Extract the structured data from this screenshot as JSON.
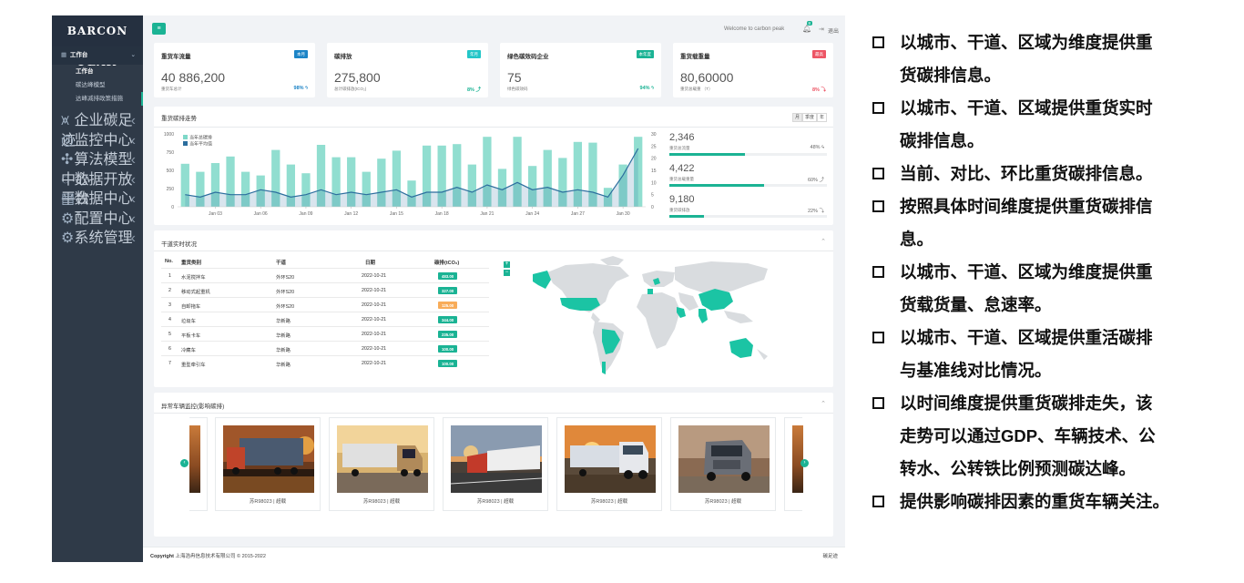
{
  "sidebar": {
    "logo": "BARCON PEAK",
    "workbench": {
      "label": "工作台",
      "subs": [
        "工作台",
        "碳达峰模型",
        "达峰减排政策措施"
      ]
    },
    "items": [
      {
        "label": "企业碳足迹",
        "icon": "graph-icon"
      },
      {
        "label": "监控中心",
        "icon": "eye-icon"
      },
      {
        "label": "算法模型中心",
        "icon": "puzzle-icon"
      },
      {
        "label": "数据开放平台",
        "icon": "circle-icon"
      },
      {
        "label": "数据中心",
        "icon": "database-icon"
      },
      {
        "label": "配置中心",
        "icon": "settings-icon"
      },
      {
        "label": "系统管理",
        "icon": "gears-icon"
      }
    ]
  },
  "topbar": {
    "menu_icon": "≡",
    "welcome": "Welcome to carbon peak",
    "bell_count": "8",
    "logout": "退出"
  },
  "stats": [
    {
      "title": "重货车流量",
      "tag": "本月",
      "tag_color": "#1c84c6",
      "value": "40 886,200",
      "sub": "重货车总计",
      "pct": "98%",
      "pct_color": "#1c84c6"
    },
    {
      "title": "碳排放",
      "tag": "年月",
      "tag_color": "#23c6c8",
      "value": "275,800",
      "sub": "总计碳排放(tCO₂)",
      "pct": "8%",
      "pct_color": "#1ab394"
    },
    {
      "title": "绿色碳效码企业",
      "tag": "本年度",
      "tag_color": "#1ab394",
      "value": "75",
      "sub": "绿色碳效码",
      "pct": "94%",
      "pct_color": "#1ab394"
    },
    {
      "title": "重货载重量",
      "tag": "最高",
      "tag_color": "#ed5565",
      "value": "80,60000",
      "sub": "重货总载重 （T）",
      "pct": "8%",
      "pct_color": "#ed5565"
    }
  ],
  "trend": {
    "title": "重货碳排走势",
    "tabs": [
      "月",
      "季度",
      "年"
    ],
    "kpis": [
      {
        "value": "2,346",
        "label": "重货总流量",
        "pct": "48%",
        "progress": 0.48
      },
      {
        "value": "4,422",
        "label": "重货总载重量",
        "pct": "60%",
        "progress": 0.6
      },
      {
        "value": "9,180",
        "label": "重货碳排放",
        "pct": "22%",
        "progress": 0.22
      }
    ]
  },
  "chart_data": {
    "type": "bar",
    "x": [
      "Jan 01",
      "Jan 02",
      "Jan 03",
      "Jan 04",
      "Jan 05",
      "Jan 06",
      "Jan 07",
      "Jan 08",
      "Jan 09",
      "Jan 10",
      "Jan 11",
      "Jan 12",
      "Jan 13",
      "Jan 14",
      "Jan 15",
      "Jan 16",
      "Jan 17",
      "Jan 18",
      "Jan 19",
      "Jan 20",
      "Jan 21",
      "Jan 22",
      "Jan 23",
      "Jan 24",
      "Jan 25",
      "Jan 26",
      "Jan 27",
      "Jan 28",
      "Jan 29",
      "Jan 30",
      "Jan 31"
    ],
    "xticks": [
      "Jan 03",
      "Jan 06",
      "Jan 09",
      "Jan 12",
      "Jan 15",
      "Jan 18",
      "Jan 21",
      "Jan 24",
      "Jan 27",
      "Jan 30"
    ],
    "series": [
      {
        "name": "当年总碳排",
        "type": "bar",
        "axis": "left",
        "color": "#7ed8c8",
        "values": [
          590,
          480,
          600,
          690,
          480,
          430,
          780,
          580,
          460,
          850,
          680,
          680,
          480,
          660,
          770,
          360,
          840,
          840,
          860,
          580,
          960,
          520,
          960,
          560,
          780,
          670,
          890,
          880,
          260,
          580,
          960
        ]
      },
      {
        "name": "当年平均值",
        "type": "line",
        "axis": "right",
        "color": "#2c6e9e",
        "values": [
          5,
          4,
          6,
          5,
          5,
          7,
          6,
          4,
          5,
          7,
          5,
          6,
          5,
          6,
          7,
          4,
          6,
          6,
          8,
          6,
          9,
          7,
          10,
          7,
          8,
          6,
          7,
          6,
          4,
          13,
          24
        ]
      }
    ],
    "ylim_left": [
      0,
      1000
    ],
    "yticks_left": [
      0,
      250,
      500,
      750,
      1000
    ],
    "ylim_right": [
      0,
      30
    ],
    "yticks_right": [
      0,
      5,
      10,
      15,
      20,
      25,
      30
    ],
    "legend": "top-left",
    "grid": false
  },
  "routes": {
    "title": "干道实时状况",
    "headers": [
      "No.",
      "重货类别",
      "干道",
      "日期",
      "碳排(tCO₂)"
    ],
    "rows": [
      {
        "no": "1",
        "type": "水泥搅拌车",
        "road": "外环S20",
        "date": "2022-10-21",
        "value": "483.00",
        "color": "#1ab394"
      },
      {
        "no": "2",
        "type": "移动式起重机",
        "road": "外环S20",
        "date": "2022-10-21",
        "value": "327.00",
        "color": "#1ab394"
      },
      {
        "no": "3",
        "type": "自卸拖车",
        "road": "外环S20",
        "date": "2022-10-21",
        "value": "125.00",
        "color": "#f8ac59"
      },
      {
        "no": "4",
        "type": "垃圾车",
        "road": "华新路",
        "date": "2022-10-21",
        "value": "344.00",
        "color": "#1ab394"
      },
      {
        "no": "5",
        "type": "平板卡车",
        "road": "华新路",
        "date": "2022-10-21",
        "value": "235.00",
        "color": "#1ab394"
      },
      {
        "no": "6",
        "type": "冷藏车",
        "road": "华新路",
        "date": "2022-10-21",
        "value": "100.00",
        "color": "#1ab394"
      },
      {
        "no": "7",
        "type": "重型牵引车",
        "road": "华新路",
        "date": "2022-10-21",
        "value": "100.00",
        "color": "#1ab394"
      }
    ],
    "zoom_in": "+",
    "zoom_out": "−"
  },
  "vehicles": {
    "title": "异常车辆监控(影响碳排)",
    "items": [
      {
        "caption": "苏R98023 | 超载"
      },
      {
        "caption": "苏R98023 | 超载"
      },
      {
        "caption": "苏R98023 | 超载"
      },
      {
        "caption": "苏R98023 | 超载"
      },
      {
        "caption": "苏R98023 | 超载"
      }
    ],
    "prev": "‹",
    "next": "›"
  },
  "footer": {
    "copyright_bold": "Copyright",
    "copyright": " 上海浩冉信息技术有限公司 © 2015-2022",
    "right": "碳足迹"
  },
  "notes": [
    "以城市、干道、区域为维度提供重货碳排信息。",
    "以城市、干道、区域提供重货实时碳排信息。",
    "当前、对比、环比重货碳排信息。",
    "按照具体时间维度提供重货碳排信息。",
    "以城市、干道、区域为维度提供重货载货量、怠速率。",
    "以城市、干道、区域提供重活碳排与基准线对比情况。",
    "以时间维度提供重货碳排走失，该走势可以通过GDP、车辆技术、公转水、公转铁比例预测碳达峰。",
    "提供影响碳排因素的重货车辆关注。"
  ],
  "note_lines": [
    [
      "以城市、干道、区域为维度提供重",
      "货碳排信息。"
    ],
    [
      "以城市、干道、区域提供重货实时",
      "碳排信息。"
    ],
    [
      "当前、对比、环比重货碳排信息。"
    ],
    [
      "按照具体时间维度提供重货碳排信",
      "息。"
    ],
    [
      "以城市、干道、区域为维度提供重",
      "货载货量、怠速率。"
    ],
    [
      "以城市、干道、区域提供重活碳排",
      "与基准线对比情况。"
    ],
    [
      "以时间维度提供重货碳排走失，该",
      "走势可以通过GDP、车辆技术、公",
      "转水、公转铁比例预测碳达峰。"
    ],
    [
      "提供影响碳排因素的重货车辆关注。"
    ]
  ]
}
